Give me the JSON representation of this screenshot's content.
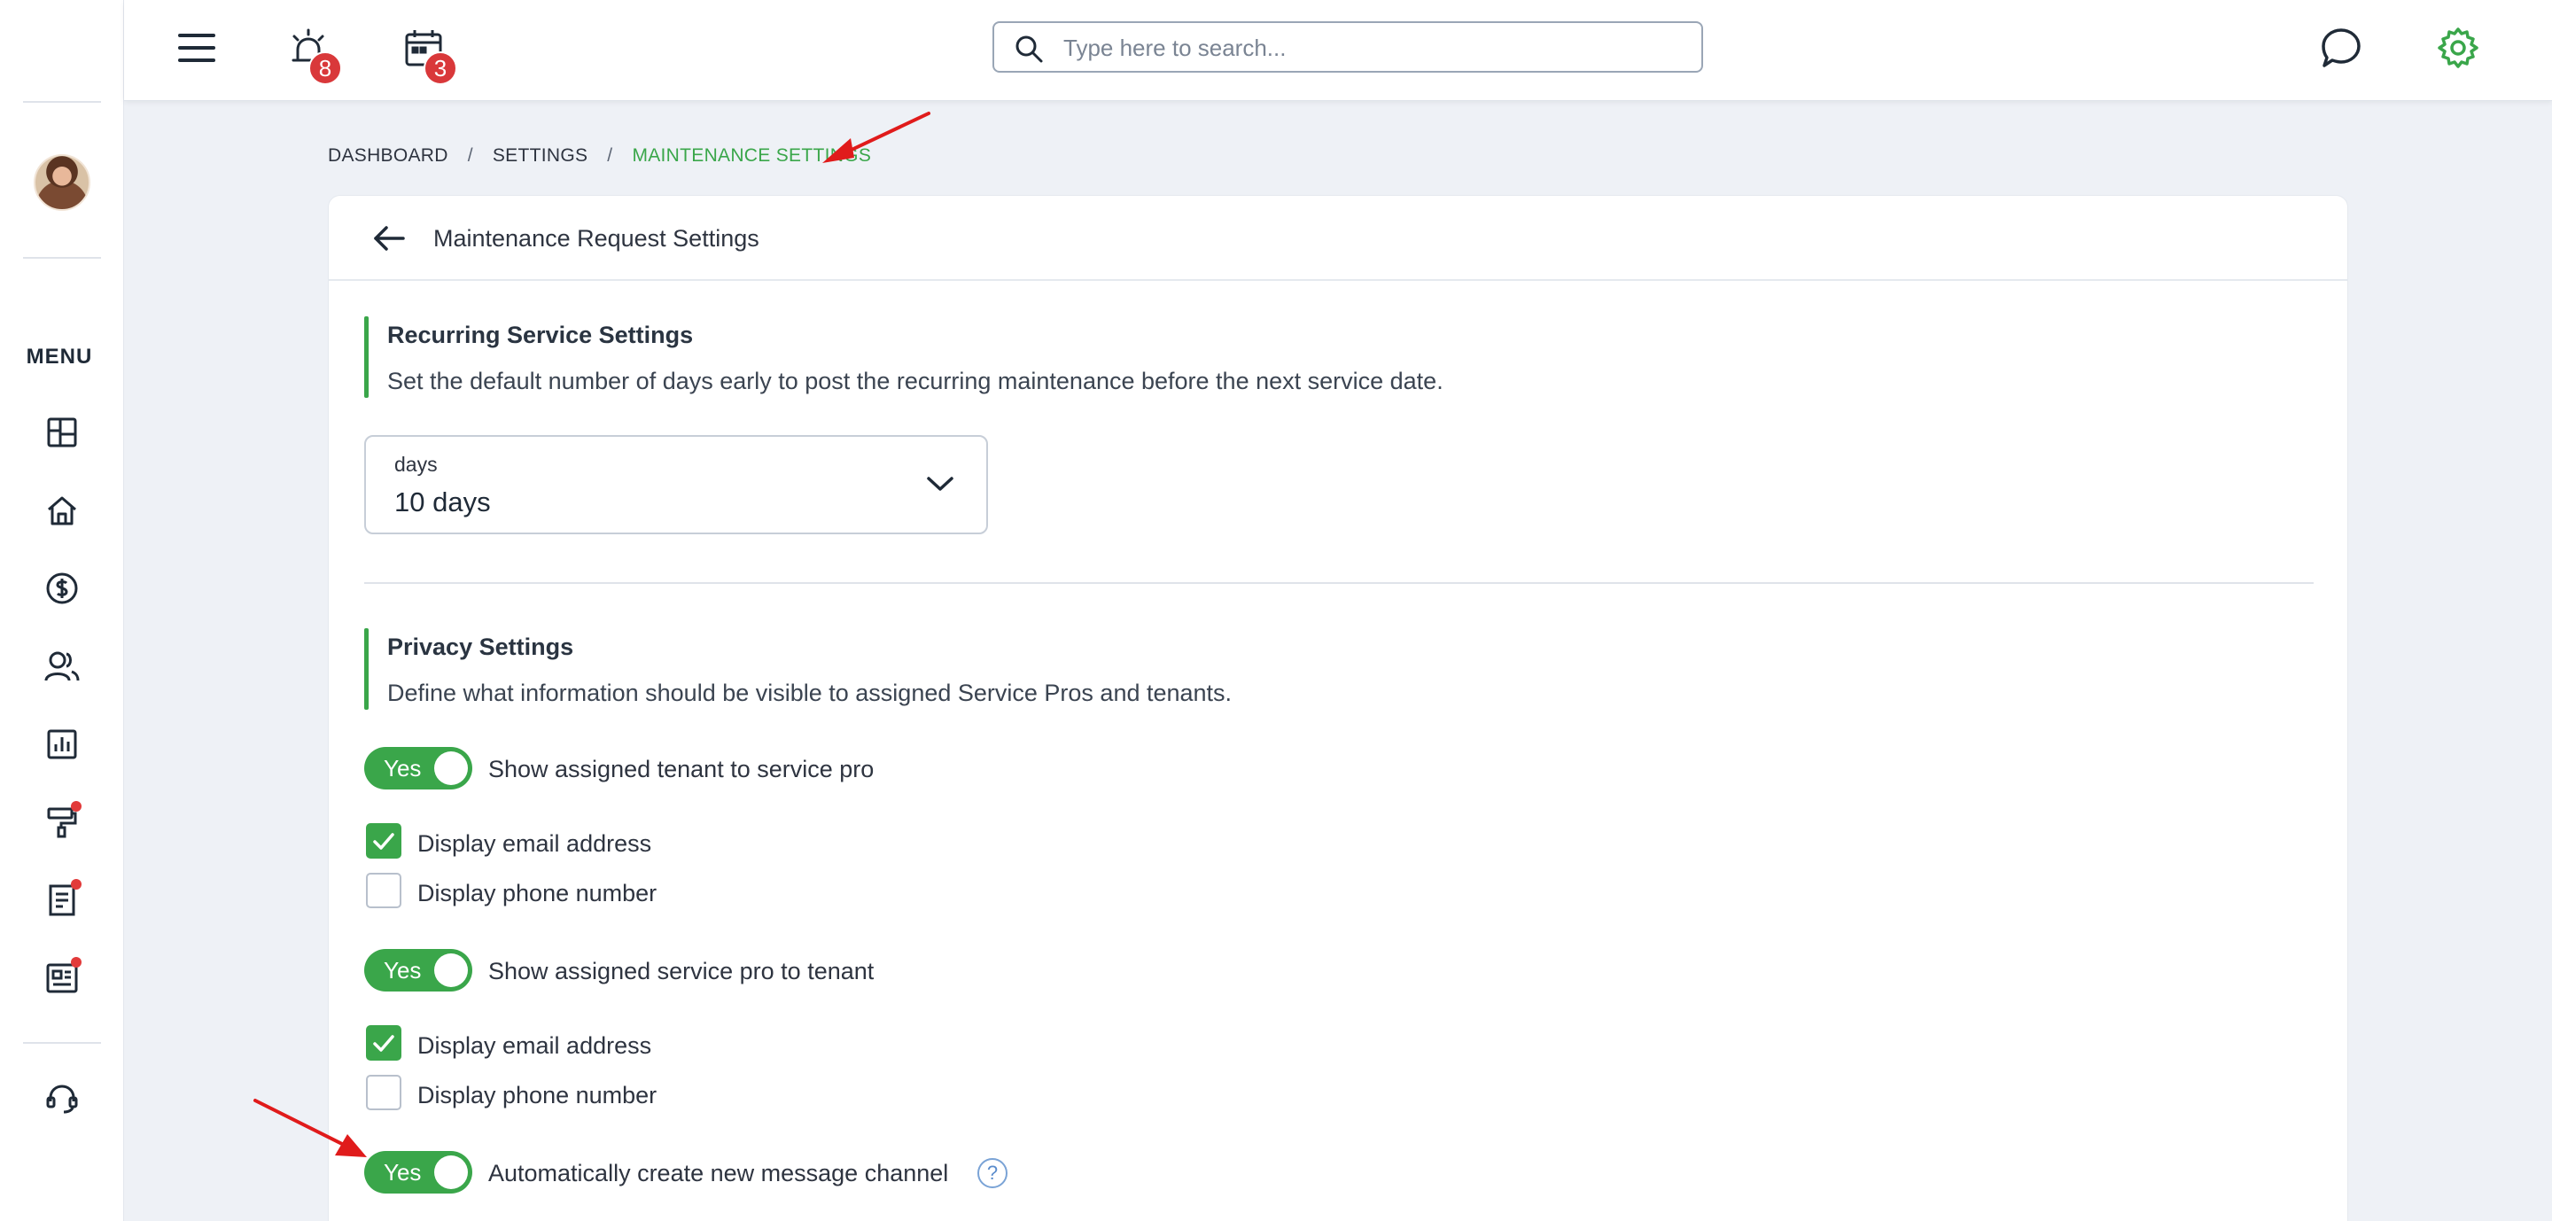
{
  "header": {
    "search_placeholder": "Type here to search...",
    "alerts_badge": "8",
    "calendar_badge": "3"
  },
  "sidebar": {
    "menu_label": "MENU"
  },
  "breadcrumb": {
    "items": [
      "DASHBOARD",
      "SETTINGS",
      "MAINTENANCE SETTINGS"
    ]
  },
  "page": {
    "title": "Maintenance Request Settings"
  },
  "recurring": {
    "title": "Recurring Service Settings",
    "description": "Set the default number of days early to post the recurring maintenance before the next service date.",
    "select_label": "days",
    "select_value": "10 days"
  },
  "privacy": {
    "title": "Privacy Settings",
    "description": "Define what information should be visible to assigned Service Pros and tenants.",
    "toggle_text": "Yes",
    "toggle1_label": "Show assigned tenant to service pro",
    "toggle2_label": "Show assigned service pro to tenant",
    "toggle3_label": "Automatically create new message channel",
    "email_label": "Display email address",
    "phone_label": "Display phone number"
  },
  "colors": {
    "accent": "#3aa64a",
    "badge": "#d9383a",
    "annotation_arrow": "#e01b1b"
  }
}
